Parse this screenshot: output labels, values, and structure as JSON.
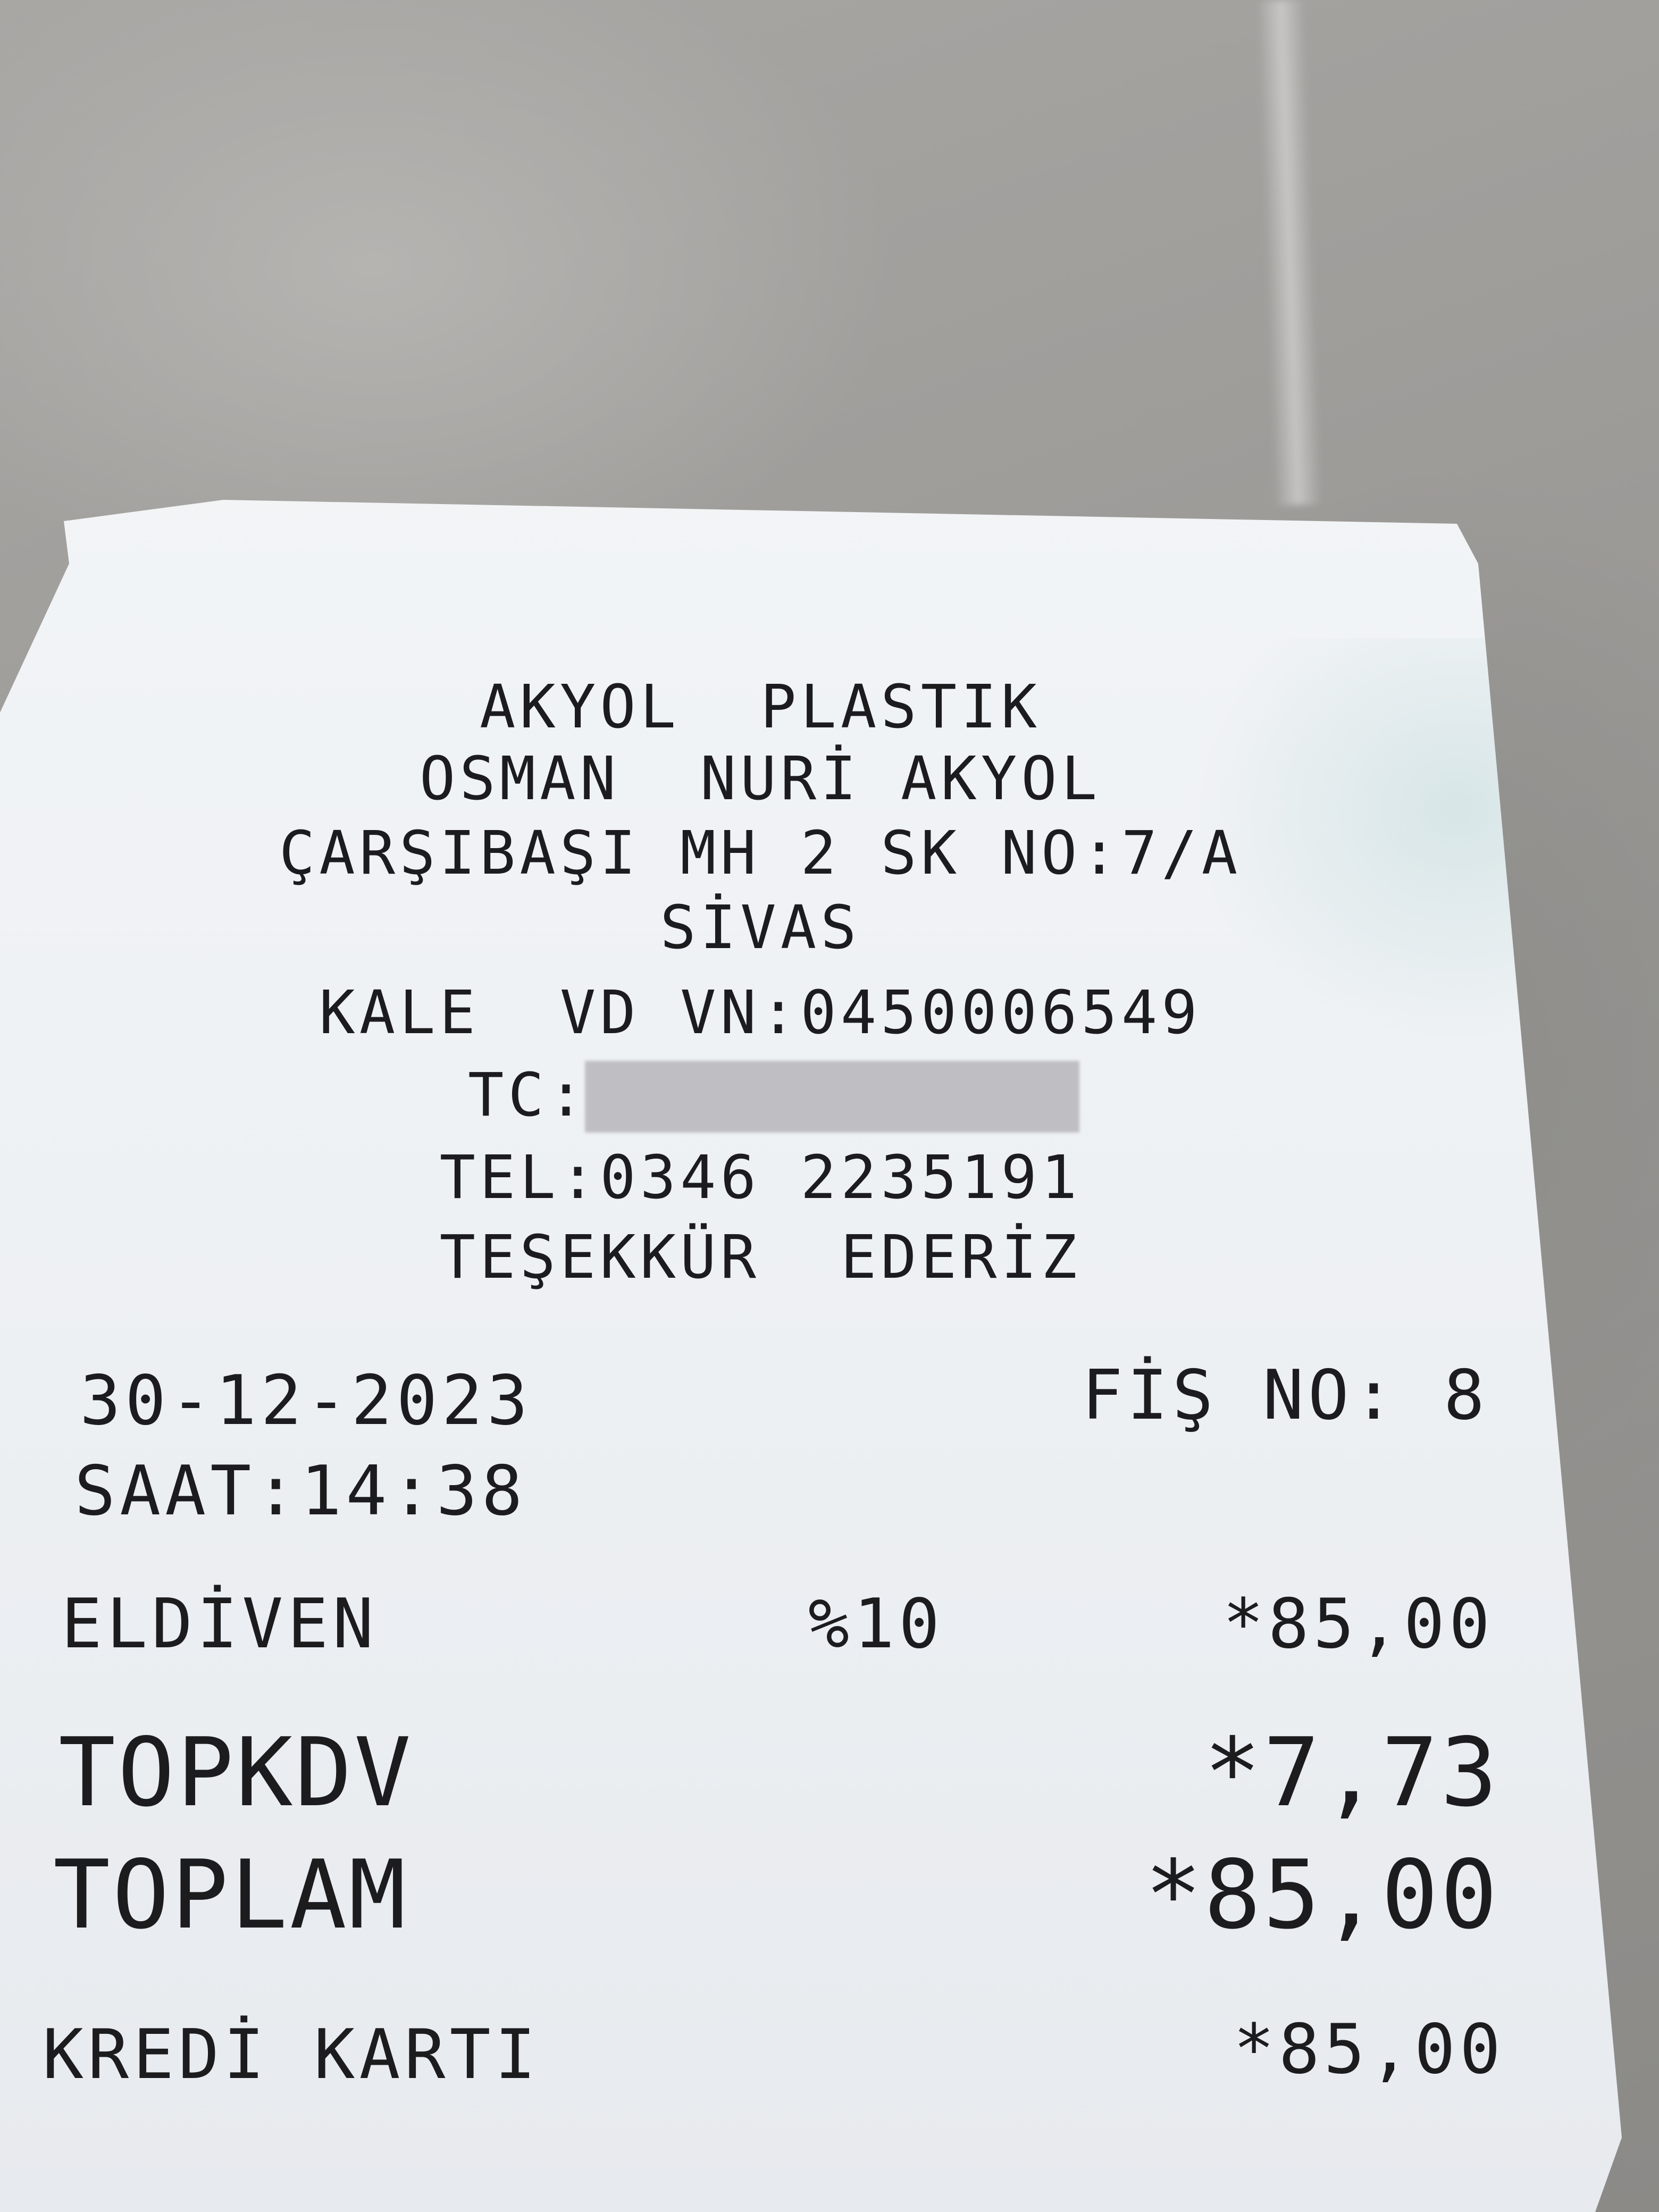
{
  "header": {
    "store_name": "AKYOL  PLASTIK",
    "owner": "OSMAN  NURİ AKYOL",
    "address": "ÇARŞIBAŞI MH 2 SK NO:7/A",
    "city": "SİVAS",
    "tax_office": "KALE  VD VN:0450006549",
    "tc_label": "TC:",
    "phone": "TEL:0346 2235191",
    "thanks": "TEŞEKKÜR  EDERİZ"
  },
  "meta": {
    "date": "30-12-2023",
    "receipt_no": "FİŞ NO: 8",
    "time": "SAAT:14:38"
  },
  "items": [
    {
      "name": "ELDİVEN",
      "vat": "%10",
      "amount": "*85,00"
    }
  ],
  "totals": {
    "vat_label": "TOPKDV",
    "vat_value": "*7,73",
    "total_label": "TOPLAM",
    "total_value": "*85,00"
  },
  "payment": {
    "method": "KREDİ KARTI",
    "amount": "*85,00"
  }
}
